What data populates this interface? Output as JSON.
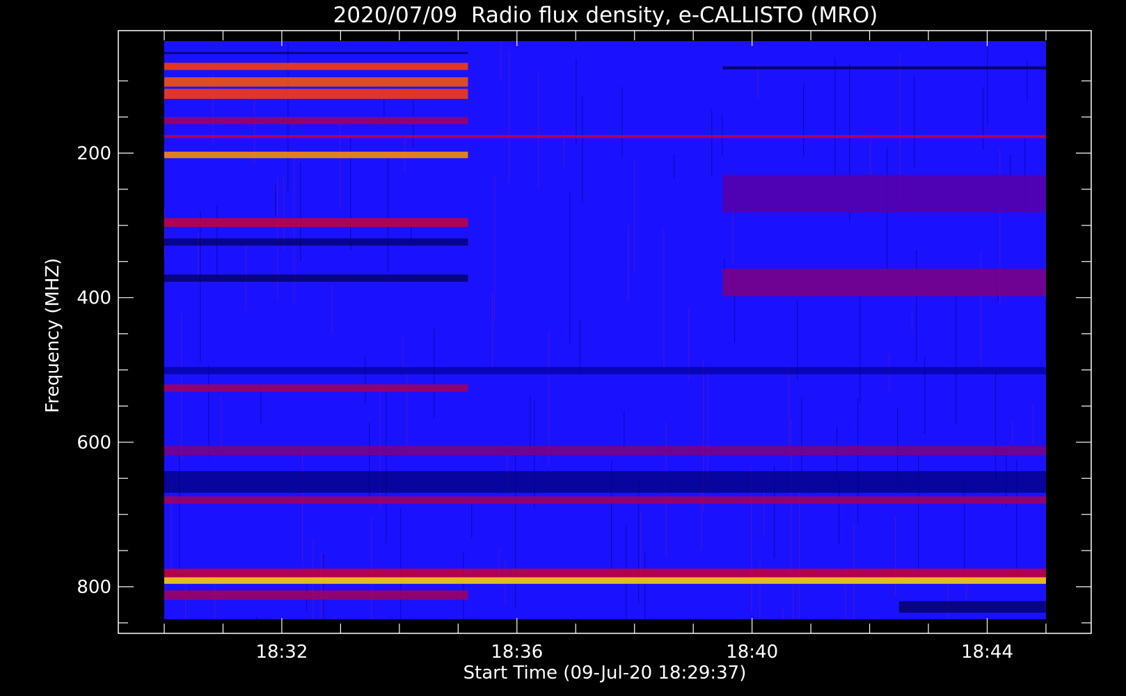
{
  "chart_data": {
    "type": "heatmap",
    "title": "2020/07/09  Radio flux density, e-CALLISTO (MRO)",
    "xlabel": "Start Time (09-Jul-20 18:29:37)",
    "ylabel": "Frequency (MHZ)",
    "y_axis": {
      "range": [
        45,
        870
      ],
      "inverted": true,
      "ticks": [
        200,
        400,
        600,
        800
      ],
      "tick_labels": [
        "200",
        "400",
        "600",
        "800"
      ],
      "minor_ticks": [
        100,
        150,
        250,
        300,
        350,
        450,
        500,
        550,
        650,
        700,
        750,
        850
      ]
    },
    "x_axis": {
      "range": [
        "18:29:37",
        "18:45:00"
      ],
      "ticks": [
        "18:32",
        "18:36",
        "18:40",
        "18:44"
      ],
      "tick_labels": [
        "18:32",
        "18:36",
        "18:40",
        "18:44"
      ],
      "minor_ticks": [
        "18:30",
        "18:31",
        "18:33",
        "18:34",
        "18:35",
        "18:37",
        "18:38",
        "18:39",
        "18:41",
        "18:42",
        "18:43",
        "18:45"
      ]
    },
    "data_extent": {
      "time_start": "18:30:00",
      "time_end": "18:45:00",
      "freq_min": 45,
      "freq_max": 845
    },
    "colormap": [
      "#000000",
      "#0000ff",
      "#ff0000",
      "#ffff00"
    ],
    "background_color": "#1a12ff",
    "bands": [
      {
        "freq": [
          75,
          85
        ],
        "t": [
          "18:30:00",
          "18:35:10"
        ],
        "level": 0.75
      },
      {
        "freq": [
          95,
          108
        ],
        "t": [
          "18:30:00",
          "18:35:10"
        ],
        "level": 0.78
      },
      {
        "freq": [
          111,
          125
        ],
        "t": [
          "18:30:00",
          "18:35:10"
        ],
        "level": 0.75
      },
      {
        "freq": [
          198,
          207
        ],
        "t": [
          "18:30:00",
          "18:35:10"
        ],
        "level": 0.86
      },
      {
        "freq": [
          290,
          302
        ],
        "t": [
          "18:30:00",
          "18:35:10"
        ],
        "level": 0.6
      },
      {
        "freq": [
          150,
          160
        ],
        "t": [
          "18:30:00",
          "18:35:10"
        ],
        "level": 0.55
      },
      {
        "freq": [
          175,
          179
        ],
        "t": [
          "18:30:00",
          "18:45:00"
        ],
        "level": 0.6
      },
      {
        "freq": [
          60,
          63
        ],
        "t": [
          "18:30:00",
          "18:35:10"
        ],
        "level": 0.1
      },
      {
        "freq": [
          80,
          84
        ],
        "t": [
          "18:39:30",
          "18:45:00"
        ],
        "level": 0.05
      },
      {
        "freq": [
          318,
          328
        ],
        "t": [
          "18:30:00",
          "18:35:10"
        ],
        "level": 0.12
      },
      {
        "freq": [
          368,
          378
        ],
        "t": [
          "18:30:00",
          "18:35:10"
        ],
        "level": 0.1
      },
      {
        "freq": [
          496,
          506
        ],
        "t": [
          "18:30:00",
          "18:45:00"
        ],
        "level": 0.2
      },
      {
        "freq": [
          520,
          530
        ],
        "t": [
          "18:30:00",
          "18:35:10"
        ],
        "level": 0.55
      },
      {
        "freq": [
          605,
          618
        ],
        "t": [
          "18:30:00",
          "18:45:00"
        ],
        "level": 0.5
      },
      {
        "freq": [
          640,
          670
        ],
        "t": [
          "18:30:00",
          "18:45:00"
        ],
        "level": 0.15
      },
      {
        "freq": [
          675,
          685
        ],
        "t": [
          "18:30:00",
          "18:45:00"
        ],
        "level": 0.55
      },
      {
        "freq": [
          775,
          790
        ],
        "t": [
          "18:30:00",
          "18:45:00"
        ],
        "level": 0.6
      },
      {
        "freq": [
          787,
          796
        ],
        "t": [
          "18:30:00",
          "18:45:00"
        ],
        "level": 0.95
      },
      {
        "freq": [
          805,
          818
        ],
        "t": [
          "18:30:00",
          "18:35:10"
        ],
        "level": 0.55
      },
      {
        "freq": [
          820,
          836
        ],
        "t": [
          "18:42:30",
          "18:45:00"
        ],
        "level": 0.1
      },
      {
        "freq": [
          360,
          398
        ],
        "t": [
          "18:39:30",
          "18:45:00"
        ],
        "level": 0.5
      },
      {
        "freq": [
          230,
          282
        ],
        "t": [
          "18:39:30",
          "18:45:00"
        ],
        "level": 0.45
      }
    ]
  }
}
